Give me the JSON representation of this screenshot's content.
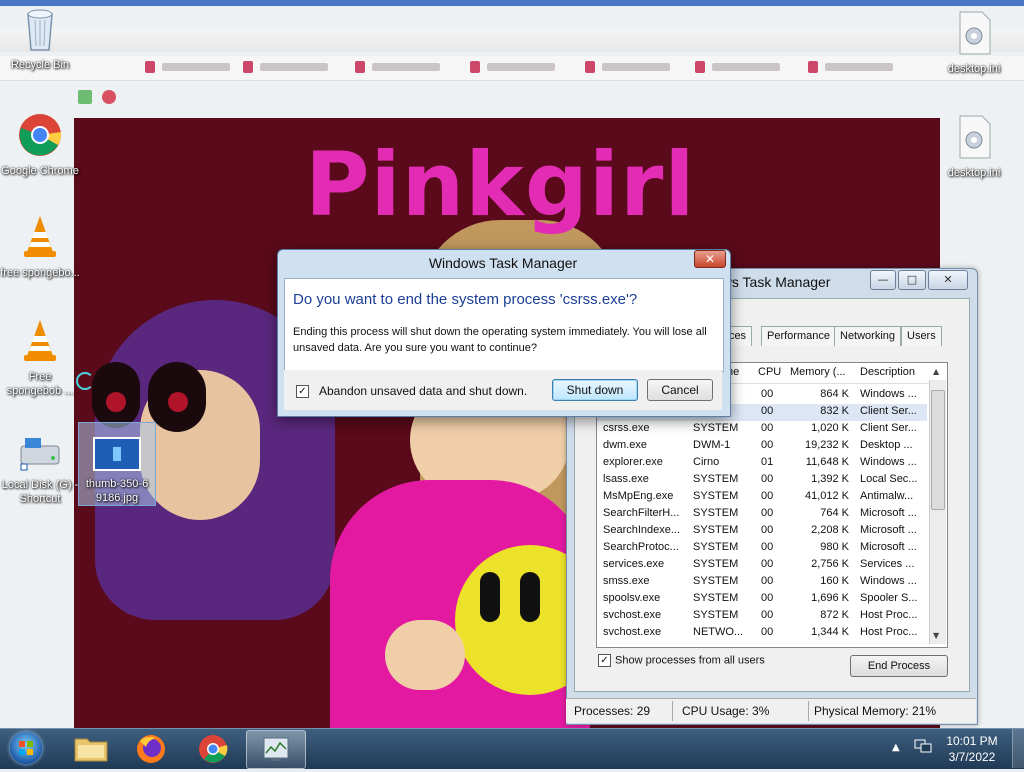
{
  "desktop": {
    "icons_left": [
      {
        "label": "Recycle Bin"
      },
      {
        "label": "Google Chrome"
      },
      {
        "label": "free spongebo..."
      },
      {
        "label": "Free spongebob ..."
      },
      {
        "label": "Local Disk (G) - Shortcut"
      },
      {
        "label": "thumb-350-6 9186.jpg"
      }
    ],
    "icons_right": [
      {
        "label": "desktop.ini"
      },
      {
        "label": "desktop.ini"
      }
    ]
  },
  "background_page": {
    "title": "Pinkgirl"
  },
  "task_manager": {
    "title": "Windows Task Manager",
    "title_visible": "ows Task Manager",
    "tabs": [
      "vices",
      "Performance",
      "Networking",
      "Users"
    ],
    "columns": {
      "name": "me",
      "cpu": "CPU",
      "memory": "Memory (...",
      "description": "Description"
    },
    "rows": [
      {
        "name": "",
        "user": "",
        "cpu": "00",
        "mem": "864 K",
        "desc": "Windows ..."
      },
      {
        "name": "",
        "user": "",
        "cpu": "00",
        "mem": "832 K",
        "desc": "Client Ser..."
      },
      {
        "name": "csrss.exe",
        "user": "SYSTEM",
        "cpu": "00",
        "mem": "1,020 K",
        "desc": "Client Ser..."
      },
      {
        "name": "dwm.exe",
        "user": "DWM-1",
        "cpu": "00",
        "mem": "19,232 K",
        "desc": "Desktop ..."
      },
      {
        "name": "explorer.exe",
        "user": "Cirno",
        "cpu": "01",
        "mem": "11,648 K",
        "desc": "Windows ..."
      },
      {
        "name": "lsass.exe",
        "user": "SYSTEM",
        "cpu": "00",
        "mem": "1,392 K",
        "desc": "Local Sec..."
      },
      {
        "name": "MsMpEng.exe",
        "user": "SYSTEM",
        "cpu": "00",
        "mem": "41,012 K",
        "desc": "Antimalw..."
      },
      {
        "name": "SearchFilterH...",
        "user": "SYSTEM",
        "cpu": "00",
        "mem": "764 K",
        "desc": "Microsoft ..."
      },
      {
        "name": "SearchIndexe...",
        "user": "SYSTEM",
        "cpu": "00",
        "mem": "2,208 K",
        "desc": "Microsoft ..."
      },
      {
        "name": "SearchProtoc...",
        "user": "SYSTEM",
        "cpu": "00",
        "mem": "980 K",
        "desc": "Microsoft ..."
      },
      {
        "name": "services.exe",
        "user": "SYSTEM",
        "cpu": "00",
        "mem": "2,756 K",
        "desc": "Services ..."
      },
      {
        "name": "smss.exe",
        "user": "SYSTEM",
        "cpu": "00",
        "mem": "160 K",
        "desc": "Windows ..."
      },
      {
        "name": "spoolsv.exe",
        "user": "SYSTEM",
        "cpu": "00",
        "mem": "1,696 K",
        "desc": "Spooler S..."
      },
      {
        "name": "svchost.exe",
        "user": "SYSTEM",
        "cpu": "00",
        "mem": "872 K",
        "desc": "Host Proc..."
      },
      {
        "name": "svchost.exe",
        "user": "NETWO...",
        "cpu": "00",
        "mem": "1,344 K",
        "desc": "Host Proc..."
      }
    ],
    "show_all_label": "Show processes from all users",
    "end_process_label": "End Process",
    "status": {
      "processes": "Processes: 29",
      "cpu": "CPU Usage: 3%",
      "memory": "Physical Memory: 21%"
    }
  },
  "dialog": {
    "title": "Windows Task Manager",
    "close_label": "✕",
    "heading": "Do you want to end the system process 'csrss.exe'?",
    "message": "Ending this process will shut down the operating system immediately.  You will lose all unsaved data.  Are you sure you want to continue?",
    "checkbox_label": "Abandon unsaved data and shut down.",
    "checkbox_checked": true,
    "primary_button": "Shut down",
    "cancel_button": "Cancel"
  },
  "taskbar": {
    "time": "10:01 PM",
    "date": "3/7/2022"
  },
  "colors": {
    "dialog_heading": "#1c3f95",
    "pink_title": "#e22cb3",
    "page_background": "#5a0a1a"
  }
}
